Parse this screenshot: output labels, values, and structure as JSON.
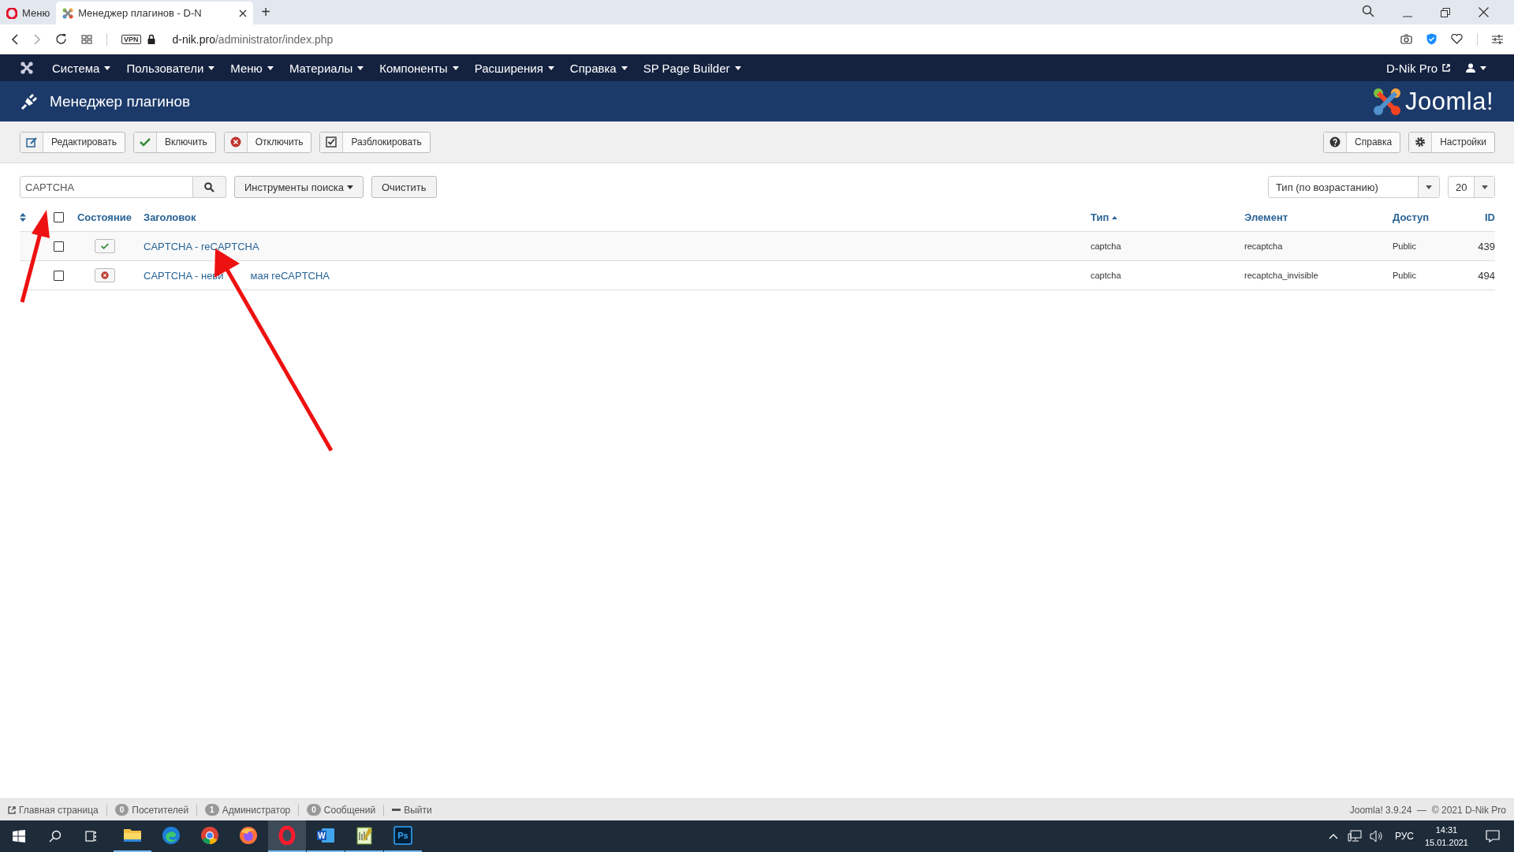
{
  "browser": {
    "tabs": [
      {
        "label": "Меню",
        "kind": "opera",
        "selected": false
      },
      {
        "label": "Менеджер плагинов - D-N",
        "kind": "joomla",
        "selected": true
      }
    ],
    "new_tab": "+",
    "vpn": "VPN",
    "url_host": "d-nik.pro",
    "url_path": "/administrator/index.php"
  },
  "nav": {
    "items": [
      "Система",
      "Пользователи",
      "Меню",
      "Материалы",
      "Компоненты",
      "Расширения",
      "Справка",
      "SP Page Builder"
    ],
    "site_link": "D-Nik Pro"
  },
  "header": {
    "title": "Менеджер плагинов",
    "logo": "Joomla!"
  },
  "toolbar": {
    "left": [
      {
        "label": "Редактировать",
        "kind": "edit"
      },
      {
        "label": "Включить",
        "kind": "enable"
      },
      {
        "label": "Отключить",
        "kind": "disable"
      },
      {
        "label": "Разблокировать",
        "kind": "unlock"
      }
    ],
    "right": [
      {
        "label": "Справка",
        "kind": "help"
      },
      {
        "label": "Настройки",
        "kind": "options"
      }
    ]
  },
  "filters": {
    "search": "CAPTCHA",
    "tools": "Инструменты поиска",
    "clear": "Очистить",
    "sort": "Тип (по возрастанию)",
    "limit": "20"
  },
  "table": {
    "columns": [
      {
        "label": "Состояние",
        "sorted": false
      },
      {
        "label": "Заголовок",
        "sorted": false
      },
      {
        "label": "Тип",
        "sorted": true
      },
      {
        "label": "Элемент",
        "sorted": false
      },
      {
        "label": "Доступ",
        "sorted": false
      },
      {
        "label": "ID",
        "sorted": false
      }
    ],
    "all_checked": false,
    "rows": [
      {
        "checked": false,
        "enabled": true,
        "title_parts": [
          "CAPTCHA - reCAPTCHA"
        ],
        "type": "captcha",
        "element": "recaptcha",
        "access": "Public",
        "id": "439"
      },
      {
        "checked": false,
        "enabled": false,
        "title_parts": [
          "CAPTCHA - неви",
          "мая reCAPTCHA"
        ],
        "type": "captcha",
        "element": "recaptcha_invisible",
        "access": "Public",
        "id": "494"
      }
    ]
  },
  "footer": {
    "items": [
      {
        "label": "Главная страница",
        "kind": "link"
      },
      {
        "count": "0",
        "label": "Посетителей",
        "kind": "count"
      },
      {
        "count": "1",
        "label": "Администратор",
        "kind": "count"
      },
      {
        "count": "0",
        "label": "Сообщений",
        "kind": "count"
      },
      {
        "label": "Выйти",
        "kind": "logout"
      }
    ],
    "copyright": "Joomla! 3.9.24  —  © 2021 D-Nik Pro"
  },
  "taskbar": {
    "apps": [
      {
        "kind": "explorer",
        "running": true,
        "active": false
      },
      {
        "kind": "edge",
        "running": false,
        "active": false
      },
      {
        "kind": "chrome",
        "running": false,
        "active": false
      },
      {
        "kind": "firefox",
        "running": false,
        "active": false
      },
      {
        "kind": "opera",
        "running": true,
        "active": true
      },
      {
        "kind": "word",
        "label": "W",
        "running": true,
        "active": false
      },
      {
        "kind": "notepad",
        "running": true,
        "active": false
      },
      {
        "kind": "photoshop",
        "label": "Ps",
        "running": true,
        "active": false
      }
    ],
    "lang": "РУС",
    "time": "14:31",
    "date": "15.01.2021"
  }
}
